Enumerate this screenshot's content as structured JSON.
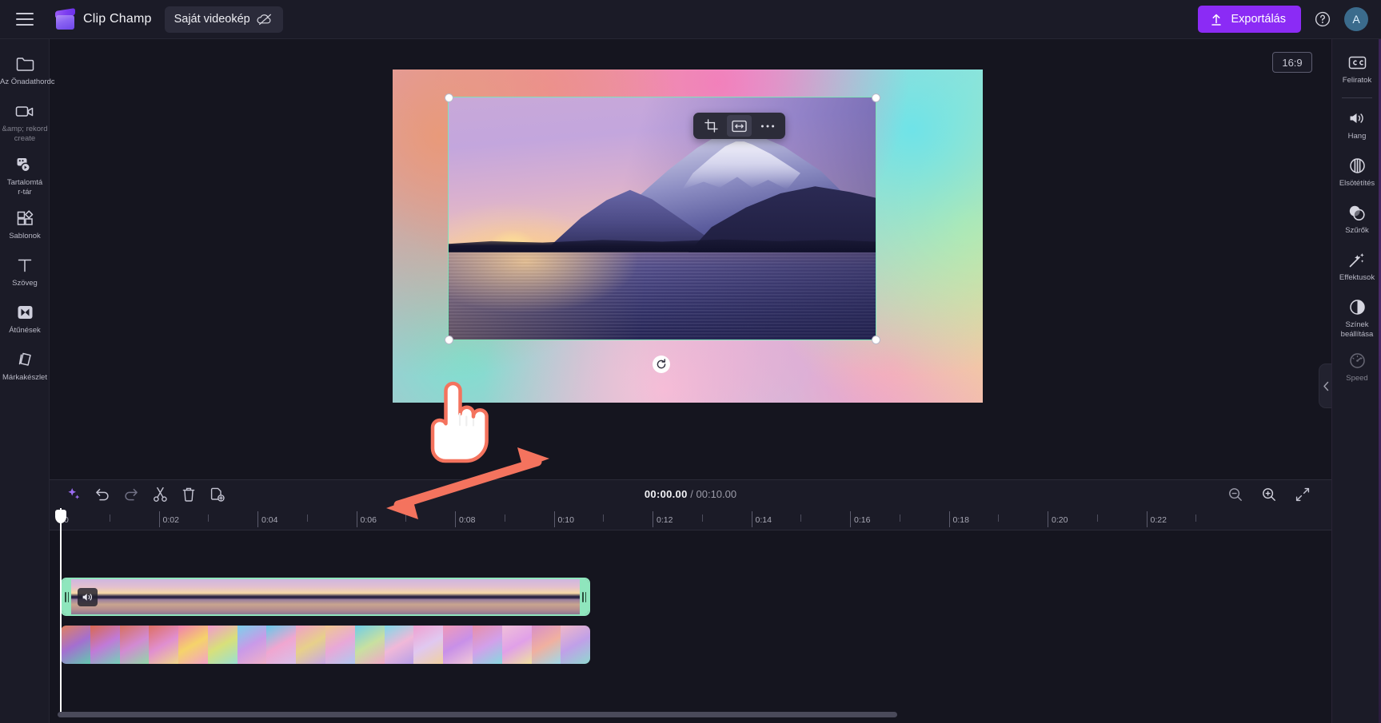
{
  "app": {
    "brand_name": "Clip Champ",
    "project_name": "Saját videokép",
    "accent_color": "#8b2bf5",
    "selection_color": "#8fe6bd",
    "annotation_color": "#f4735e"
  },
  "topbar": {
    "menu_icon": "hamburger-icon",
    "logo_icon": "clipchamp-logo-icon",
    "cloud_off_icon": "cloud-off-icon",
    "export_label": "Exportálás",
    "export_icon": "upload-icon",
    "help_icon": "help-circle-icon",
    "avatar_initial": "A"
  },
  "left_sidebar": {
    "items": [
      {
        "label": "Az Önadathordozója",
        "icon": "folder-icon",
        "dim": false
      },
      {
        "label": "&amp; rekord\ncreate",
        "icon": "video-camera-icon",
        "dim": true
      },
      {
        "label": "Tartalomtá\nr-tár",
        "icon": "content-library-icon",
        "dim": false
      },
      {
        "label": "Sablonok",
        "icon": "templates-grid-icon",
        "dim": false
      },
      {
        "label": "Szöveg",
        "icon": "text-t-icon",
        "dim": false
      },
      {
        "label": "Átűnések",
        "icon": "transitions-icon",
        "dim": false
      },
      {
        "label": "Márkakészlet",
        "icon": "brand-kit-icon",
        "dim": false
      }
    ],
    "collapse_icon": "chevron-right-icon"
  },
  "right_sidebar": {
    "items": [
      {
        "label": "Feliratok",
        "icon": "closed-captions-icon",
        "dim": false
      },
      {
        "label": "Hang",
        "icon": "speaker-volume-icon",
        "dim": false
      },
      {
        "label": "Elsötétítés",
        "icon": "fade-icon",
        "dim": false
      },
      {
        "label": "Szűrők",
        "icon": "filters-circles-icon",
        "dim": false
      },
      {
        "label": "Effektusok",
        "icon": "magic-wand-icon",
        "dim": false
      },
      {
        "label": "Színek beállítása",
        "icon": "contrast-half-circle-icon",
        "dim": false
      },
      {
        "label": "Speed",
        "icon": "speedometer-icon",
        "dim": true
      }
    ],
    "collapse_icon": "chevron-left-icon"
  },
  "preview": {
    "aspect_ratio": "16:9",
    "floating_toolbar": [
      {
        "icon": "crop-icon",
        "name": "crop-button"
      },
      {
        "icon": "fit-width-icon",
        "name": "fit-button"
      },
      {
        "icon": "more-horizontal-icon",
        "name": "more-options-button"
      }
    ],
    "rotate_icon": "rotate-icon",
    "magic_icon": "ai-magic-wand-off-icon",
    "fullscreen_icon": "fullscreen-icon",
    "collapse_icon": "chevron-down-icon",
    "playback": [
      {
        "icon": "skip-to-start-icon",
        "name": "skip-to-start-button"
      },
      {
        "icon": "rewind-5-icon",
        "name": "rewind-5-button"
      },
      {
        "icon": "play-icon",
        "name": "play-button"
      },
      {
        "icon": "forward-5-icon",
        "name": "forward-5-button"
      },
      {
        "icon": "skip-to-end-icon",
        "name": "skip-to-end-button"
      }
    ]
  },
  "timeline": {
    "toolbar_left": [
      {
        "icon": "ai-sparkle-icon",
        "name": "ai-tools-button"
      },
      {
        "icon": "undo-icon",
        "name": "undo-button"
      },
      {
        "icon": "redo-icon",
        "name": "redo-button"
      },
      {
        "icon": "scissors-icon",
        "name": "split-button"
      },
      {
        "icon": "trash-icon",
        "name": "delete-button"
      },
      {
        "icon": "duplicate-icon",
        "name": "duplicate-button"
      }
    ],
    "toolbar_right": [
      {
        "icon": "zoom-out-icon",
        "name": "zoom-out-button"
      },
      {
        "icon": "zoom-in-icon",
        "name": "zoom-in-button"
      },
      {
        "icon": "fit-timeline-icon",
        "name": "fit-timeline-button"
      }
    ],
    "current_time": "00:00.00",
    "separator": "/",
    "total_time": "00:10.00",
    "ruler_labels": [
      "0",
      "0:02",
      "0:04",
      "0:06",
      "0:08",
      "0:10",
      "0:12",
      "0:14",
      "0:16",
      "0:18",
      "0:20",
      "0:22"
    ],
    "tracks": [
      {
        "name": "video-clip",
        "selected": true,
        "audio_icon": "speaker-volume-icon"
      },
      {
        "name": "gradient-clip",
        "selected": false
      }
    ]
  },
  "annotations": {
    "hand_cursor": "hand-pointer-cursor",
    "resize_arrow": "double-headed-resize-arrow"
  }
}
